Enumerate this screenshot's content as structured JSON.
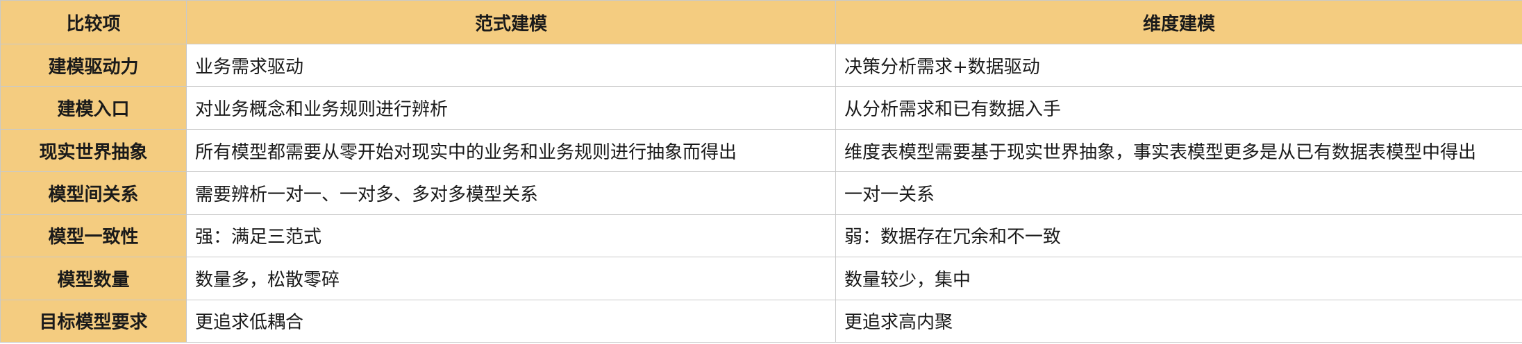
{
  "table": {
    "headers": [
      "比较项",
      "范式建模",
      "维度建模"
    ],
    "rows": [
      {
        "item": "建模驱动力",
        "normalized": "业务需求驱动",
        "dimensional": "决策分析需求+数据驱动"
      },
      {
        "item": "建模入口",
        "normalized": "对业务概念和业务规则进行辨析",
        "dimensional": "从分析需求和已有数据入手"
      },
      {
        "item": "现实世界抽象",
        "normalized": "所有模型都需要从零开始对现实中的业务和业务规则进行抽象而得出",
        "dimensional": "维度表模型需要基于现实世界抽象，事实表模型更多是从已有数据表模型中得出"
      },
      {
        "item": "模型间关系",
        "normalized": "需要辨析一对一、一对多、多对多模型关系",
        "dimensional": "一对一关系"
      },
      {
        "item": "模型一致性",
        "normalized": "强：满足三范式",
        "dimensional": "弱：数据存在冗余和不一致"
      },
      {
        "item": "模型数量",
        "normalized": "数量多，松散零碎",
        "dimensional": "数量较少，集中"
      },
      {
        "item": "目标模型要求",
        "normalized": "更追求低耦合",
        "dimensional": "更追求高内聚"
      }
    ]
  },
  "colors": {
    "header_bg": "#f4cc80",
    "border": "#c9c9c9",
    "cell_bg": "#ffffff",
    "text": "#1a1a1a"
  }
}
